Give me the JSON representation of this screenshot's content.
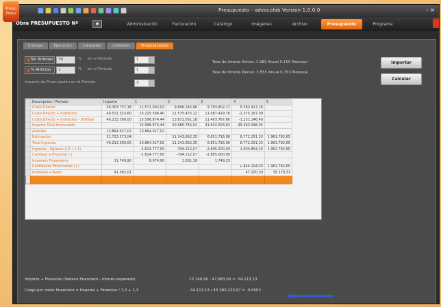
{
  "window": {
    "title": "Presupuesto - advocolab Version 1.0.0.0",
    "logo_text": "Presto Presu",
    "controls": "– ×"
  },
  "menubar": {
    "doc_name": "Obra PRESUPUESTO Nº",
    "doc_button": "▣",
    "tabs": [
      {
        "label": "Administración"
      },
      {
        "label": "Facturación"
      },
      {
        "label": "Catálogo"
      },
      {
        "label": "Imágenes"
      },
      {
        "label": "Archivo"
      },
      {
        "label": "Presupuesto",
        "active": true
      },
      {
        "label": "Programa"
      }
    ]
  },
  "subtabs": [
    "Entrega",
    "Ejecución",
    "Cláusulas",
    "Calidades",
    "Financiaciones"
  ],
  "controls": {
    "row1": {
      "check_label": "Sin Anticipo",
      "value": "30",
      "unit": "%",
      "label": "en el Periodo",
      "spin": "1"
    },
    "row2": {
      "check_label": "% Anticipo",
      "value": "1",
      "unit": "%",
      "label": "en el Periodo",
      "spin": "1"
    },
    "row3": {
      "label": "Importe de Financiación en el Periodo",
      "spin": "3"
    }
  },
  "info": {
    "line1": "Tasa de Interés Activo: 1.983 Anual 0.155 Mensual",
    "line2": "Tasa de Interés Pasivo: 3.555 Anual 0.753 Mensual"
  },
  "buttons": {
    "import": "Importar",
    "calc": "Calcular"
  },
  "table": {
    "headers": [
      "Descripción / Periodo",
      "Importe",
      "1",
      "2",
      "3",
      "4",
      "5"
    ],
    "rows": [
      [
        "Coste Directo",
        "39.303.737,18",
        "11.571.092,02",
        "9.896.245,06",
        "9.793.802,11",
        "5.382.417,16",
        ""
      ],
      [
        "Coste Directo + Indirectos",
        "40.511.323,60",
        "15.225.594,40",
        "11.575.475,12",
        "11.087.419,76",
        "-1.375.167,09",
        ""
      ],
      [
        "Coste Directo + Indirectos - Utilidad",
        "46.213.390,00",
        "15.596.874,44",
        "13.872.051,18",
        "11.493.767,60",
        "-1.231.146,49",
        ""
      ],
      [
        "Importe Total Acumulado",
        "",
        "15.596.874,44",
        "29.580.755,02",
        "41.642.593,62",
        "45.393.398,04",
        ""
      ],
      [
        "Anticipo",
        "13.864.017,02",
        "13.864.017,02",
        "",
        "",
        "",
        ""
      ],
      [
        "Estimación",
        "31.723.373,04",
        "",
        "11.143.662,35",
        "6.851.716,96",
        "8.772.251,33",
        "1.961.782,65"
      ],
      [
        "Total Ingresos",
        "46.213.390,00",
        "13.864.017,02",
        "11.143.662,35",
        "6.851.716,96",
        "8.772.251,33",
        "1.961.782,65"
      ],
      [
        "Ingresos - Egresos (I.2 + I.1)",
        "",
        "-1.624.777,00",
        "-794.212,07",
        "-2.895.000,00",
        "1.604.854,23",
        "1.961.782,65"
      ],
      [
        "Cantidad a Financiar (-)",
        "",
        "-1.624.777,00",
        "-794.212,07",
        "-2.895.000,00",
        "",
        ""
      ],
      [
        "Intereses Financieros",
        "11.749,90",
        "8.074,90",
        "1.001,16",
        "1.749,25",
        "",
        ""
      ],
      [
        "Cantidades Financiadas (+)",
        "",
        "",
        "",
        "",
        "+.644.104,33",
        "1.961.782,65"
      ],
      [
        "Intereses a Favor",
        "91.382,01",
        "",
        "",
        "",
        "47.200,30",
        "35.178,33"
      ]
    ]
  },
  "footer": {
    "line1_label": "Importe + Financiar (Valores financiero - Interés esperado)",
    "line1_value": "13.749,90 - 47.983,00 = -34.113,13",
    "line2_label": "Cargo por costo financiero = Importe + Financiar / 1,3 + 1,3",
    "line2_value": "-34.113.13 / 43.383.223,97 = -0,0003"
  },
  "colors": {
    "accent": "#f08020",
    "window_bg": "#2b2b2b",
    "arrow": "#2f5fd0"
  }
}
